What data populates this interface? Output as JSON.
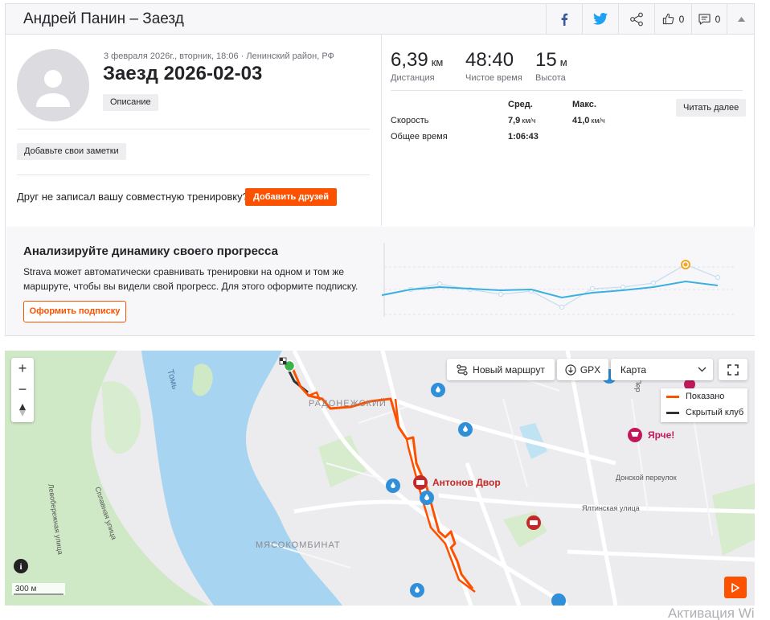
{
  "header": {
    "title": "Андрей Панин – Заезд",
    "likes_count": "0",
    "comments_count": "0"
  },
  "activity": {
    "date_location": "3 февраля 2026г., вторник, 18:06 · Ленинский район, РФ",
    "title": "Заезд 2026-02-03",
    "description_btn": "Описание",
    "notes_btn": "Добавьте свои заметки",
    "friend_text": "Друг не записал вашу совместную тренировку?",
    "add_friends_btn": "Добавить друзей"
  },
  "stats": {
    "distance": {
      "value": "6,39",
      "unit": "км",
      "label": "Дистанция"
    },
    "moving_time": {
      "value": "48:40",
      "label": "Чистое время"
    },
    "elevation": {
      "value": "15",
      "unit": "м",
      "label": "Высота"
    },
    "col_avg": "Сред.",
    "col_max": "Макс.",
    "read_more_btn": "Читать далее",
    "rows": [
      {
        "label": "Скорость",
        "avg": "7,9",
        "avg_unit": "км/ч",
        "max": "41,0",
        "max_unit": "км/ч"
      },
      {
        "label": "Общее время",
        "avg": "1:06:43"
      }
    ]
  },
  "upsell": {
    "title": "Анализируйте динамику своего прогресса",
    "description": "Strava может автоматически сравнивать тренировки на одном и том же маршруте, чтобы вы видели свой прогресс. Для этого оформите подписку.",
    "button": "Оформить подписку"
  },
  "map": {
    "new_route_btn": "Новый маршрут",
    "gpx_btn": "GPX",
    "map_type": "Карта",
    "legend_shown": "Показано",
    "legend_hidden": "Скрытый клуб",
    "scale": "300 м",
    "poi_antonov": "Антонов Двор",
    "poi_yarche": "Ярче!",
    "district_radonezh": "РАДОНЕЖСКИЙ",
    "district_myaso": "МЯСОКОМБИНАТ",
    "river": "Томь",
    "street_donskoy": "Донской переулок",
    "street_yaltinskaya": "Ялтинская улица",
    "street_sploshnaya": "Сплавная улица",
    "street_levoberezh": "Левобережная улица",
    "street_pereulok": "Пер",
    "colors": {
      "shown": "#fc5200",
      "hidden": "#333333",
      "start": "#3cb44b"
    }
  },
  "watermark": "Активация Wi"
}
